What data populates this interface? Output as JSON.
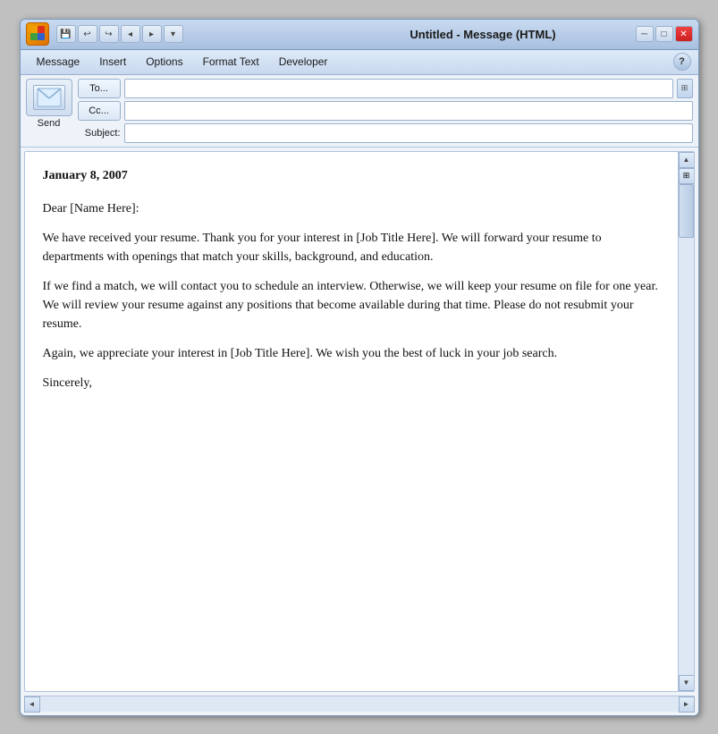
{
  "titleBar": {
    "title": "Untitled - Message (HTML)",
    "minimize": "─",
    "restore": "□",
    "close": "✕",
    "logoText": "O"
  },
  "toolbar": {
    "quickSave": "💾",
    "undo": "↩",
    "redo": "↪",
    "navLeft": "◂",
    "navRight": "▸",
    "dropdown": "▾"
  },
  "ribbon": {
    "items": [
      "Message",
      "Insert",
      "Options",
      "Format Text",
      "Developer"
    ],
    "helpLabel": "?"
  },
  "emailHeader": {
    "toLabel": "To...",
    "ccLabel": "Cc...",
    "subjectLabel": "Subject:",
    "toValue": "",
    "ccValue": "",
    "subjectValue": "",
    "sendLabel": "Send",
    "edgeBtnSymbol": "⊞"
  },
  "messageBody": {
    "date": "January 8, 2007",
    "greeting": "Dear [Name Here]:",
    "para1": "We have received your resume. Thank you for your interest in [Job Title Here]. We will forward your resume to departments with openings that match your skills, background, and education.",
    "para2": "If we find a match, we will contact you to schedule an interview. Otherwise, we will keep your resume on file for one year. We will review your resume against any positions that become available during that time. Please do not resubmit your resume.",
    "para3": "Again, we appreciate your interest in [Job Title Here]. We wish you the best of luck in your job search.",
    "closing": "Sincerely,"
  },
  "scrollbar": {
    "upArrow": "▲",
    "downArrow": "▼",
    "leftArrow": "◄",
    "rightArrow": "►",
    "cornerSymbol": "⊡"
  }
}
